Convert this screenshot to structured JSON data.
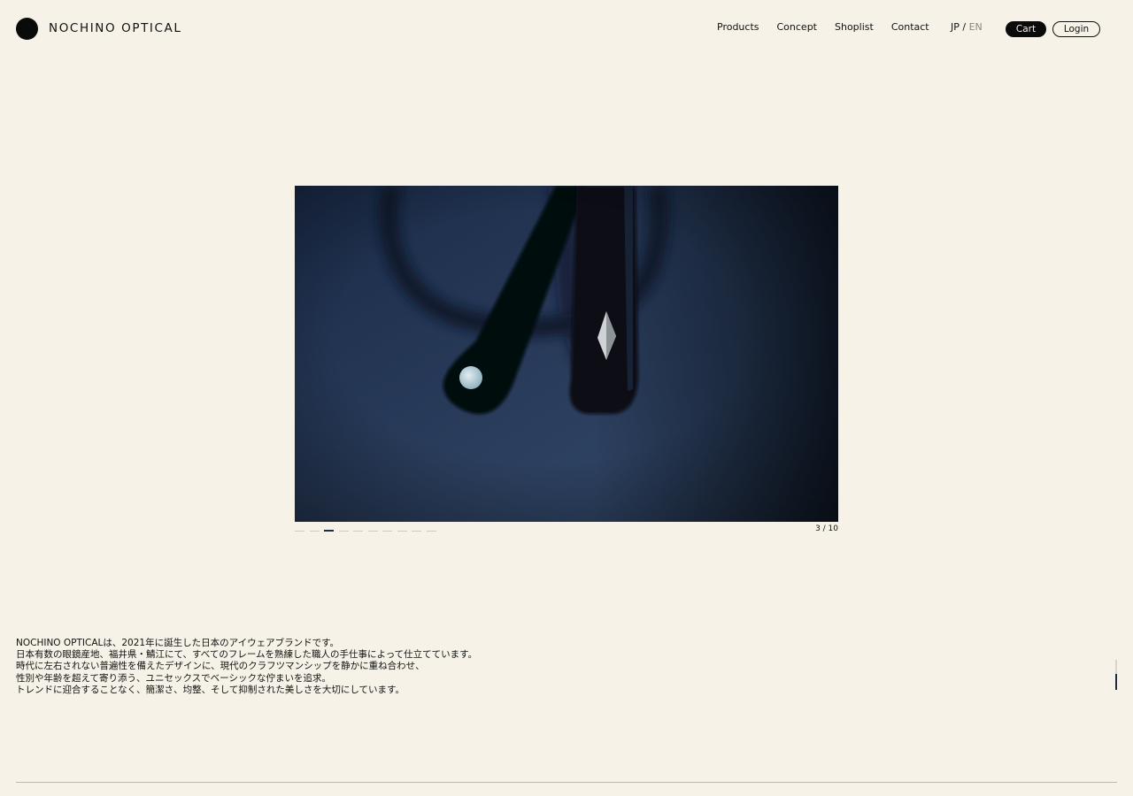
{
  "header": {
    "logo_text": "NOCHINO OPTICAL",
    "nav": [
      "Products",
      "Concept",
      "Shoplist",
      "Contact"
    ],
    "lang": {
      "jp": "JP",
      "sep": "/",
      "en": "EN"
    },
    "cart_label": "Cart",
    "login_label": "Login"
  },
  "slider": {
    "counter": "3 / 10",
    "total": 10,
    "current": 3
  },
  "about": {
    "lines": [
      "NOCHINO OPTICALは、2021年に誕生した日本のアイウェアブランドです。",
      "日本有数の眼鏡産地、福井県・鯖江にて、すべてのフレームを熟練した職人の手仕事によって仕立てています。",
      "時代に左右されない普遍性を備えたデザインに、現代のクラフツマンシップを静かに重ね合わせ、",
      "性別や年齢を超えて寄り添う、ユニセックスでベーシックな佇まいを追求。",
      "トレンドに迎合することなく、簡潔さ、均整、そして抑制された美しさを大切にしています。"
    ]
  },
  "colors": {
    "background": "#f7f2e8",
    "accent": "#1d2a48",
    "text": "#111111"
  }
}
